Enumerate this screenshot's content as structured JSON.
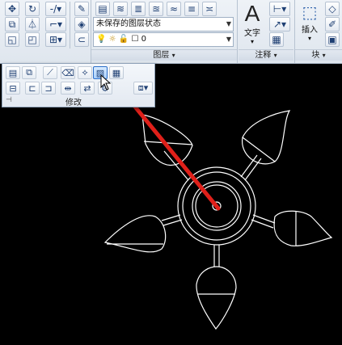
{
  "ribbon": {
    "layer_state_dropdown": "未保存的图层状态",
    "layer_dropdown_value": "0",
    "layer_panel_label": "图层",
    "annotation": {
      "text_label": "文字",
      "panel_label": "注释"
    },
    "block": {
      "insert_label": "插入",
      "panel_label": "块"
    }
  },
  "modify_panel": {
    "title": "修改"
  },
  "colors": {
    "arrow": "#e0201a",
    "drawing_lines": "#ffffff",
    "canvas_bg": "#000000"
  },
  "icons": [
    "move-icon",
    "rotate-icon",
    "trim-icon",
    "copy-icon",
    "mirror-icon",
    "fillet-icon",
    "stretch-icon",
    "scale-icon",
    "array-icon",
    "erase-icon",
    "explode-icon",
    "offset-icon",
    "layer-properties-icon",
    "text-icon",
    "dimension-icon",
    "leader-icon",
    "table-icon",
    "insert-icon",
    "edit-block-icon",
    "create-block-icon",
    "pin-icon"
  ]
}
